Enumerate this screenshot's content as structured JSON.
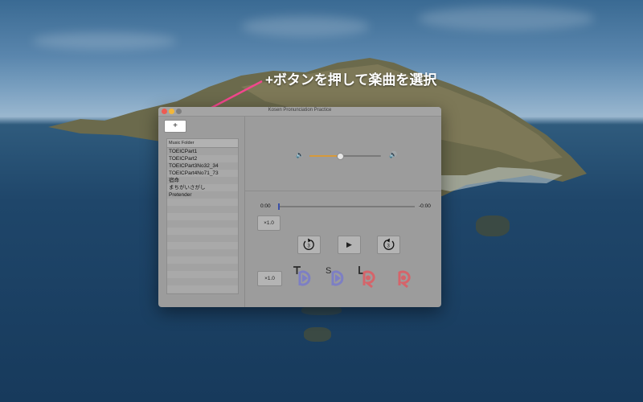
{
  "annotation": {
    "text": "+ボタンを押して楽曲を選択"
  },
  "window": {
    "title": "Kosen Pronunciation Practice"
  },
  "sidebar": {
    "add_label": "+",
    "list_header": "Music Folder",
    "items": [
      "TOEICPart1",
      "TOEICPart2",
      "TOEICPart3No32_34",
      "TOEICPart4No71_73",
      "宿命",
      "まちがいさがし",
      "Pretender"
    ]
  },
  "player": {
    "volume_level": 0.43,
    "time_elapsed": "0:00",
    "time_remaining": "-0:00",
    "progress": 0,
    "speed_top": "×1.0",
    "speed_bottom": "×1.0",
    "rewind_seconds": "3",
    "forward_seconds": "3",
    "play_symbol": "▶",
    "repeat_count": "1"
  },
  "icons": {
    "volume_low": "speaker-low-icon",
    "volume_high": "speaker-high-icon",
    "repeat": "repeat-icon",
    "rewind": "rewind-3-icon",
    "forward": "forward-3-icon",
    "practice_t": "t-play-icon",
    "practice_s": "s-play-icon",
    "practice_l": "l-record-icon",
    "practice_r": "record-icon"
  },
  "colors": {
    "accent_orange": "#d69a3a",
    "practice_blue": "#7d7fc4",
    "practice_red": "#d5646a",
    "annotation_arrow": "#f2478d"
  }
}
